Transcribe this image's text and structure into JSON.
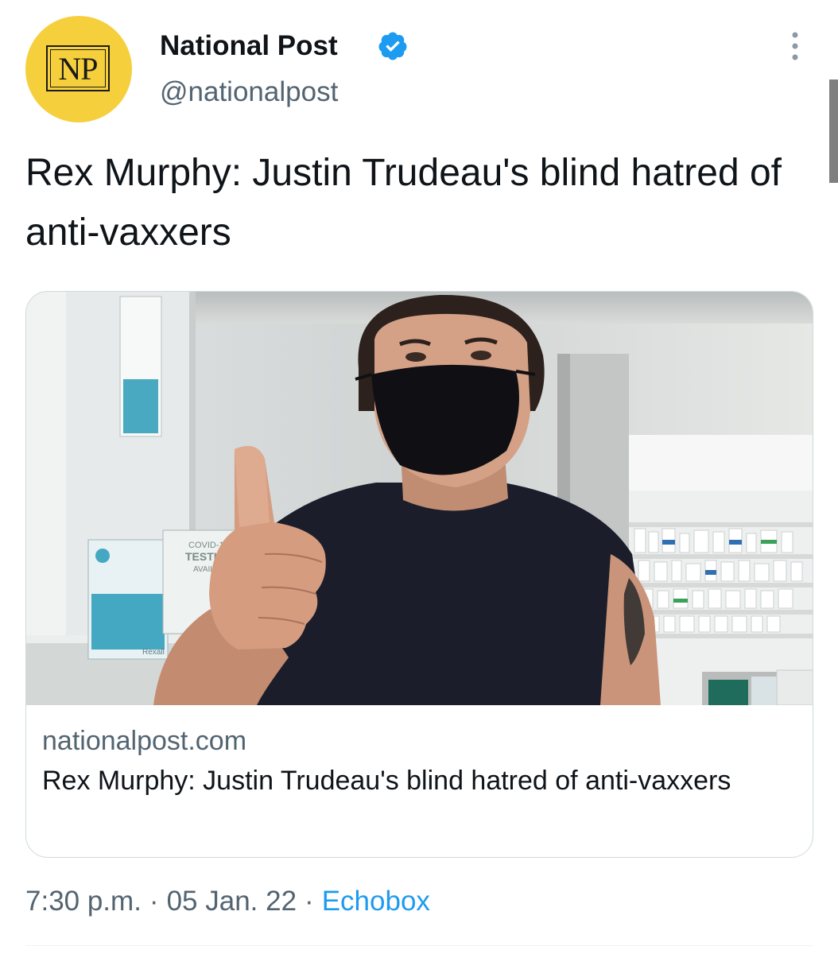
{
  "account": {
    "avatar_text": "NP",
    "display_name": "National Post",
    "handle": "@nationalpost",
    "verified": true,
    "verified_icon": "verified-badge-icon",
    "more_icon": "more-vertical-icon"
  },
  "tweet": {
    "text": "Rex Murphy: Justin Trudeau's blind hatred of anti-vaxxers"
  },
  "card": {
    "image_description_icon": "article-photo",
    "image_text": {
      "sign_line1": "COVID-1",
      "sign_line2": "TESTI",
      "sign_line3": "AVAIL",
      "store": "Rexall"
    },
    "domain": "nationalpost.com",
    "title": "Rex Murphy: Justin Trudeau's blind hatred of anti-vaxxers"
  },
  "meta": {
    "time": "7:30 p.m.",
    "date": "05 Jan. 22",
    "source": "Echobox",
    "separator": "·"
  },
  "colors": {
    "avatar_bg": "#f6cf3c",
    "verified": "#1d9bf0",
    "link": "#1d9bf0",
    "secondary_text": "#536471"
  }
}
